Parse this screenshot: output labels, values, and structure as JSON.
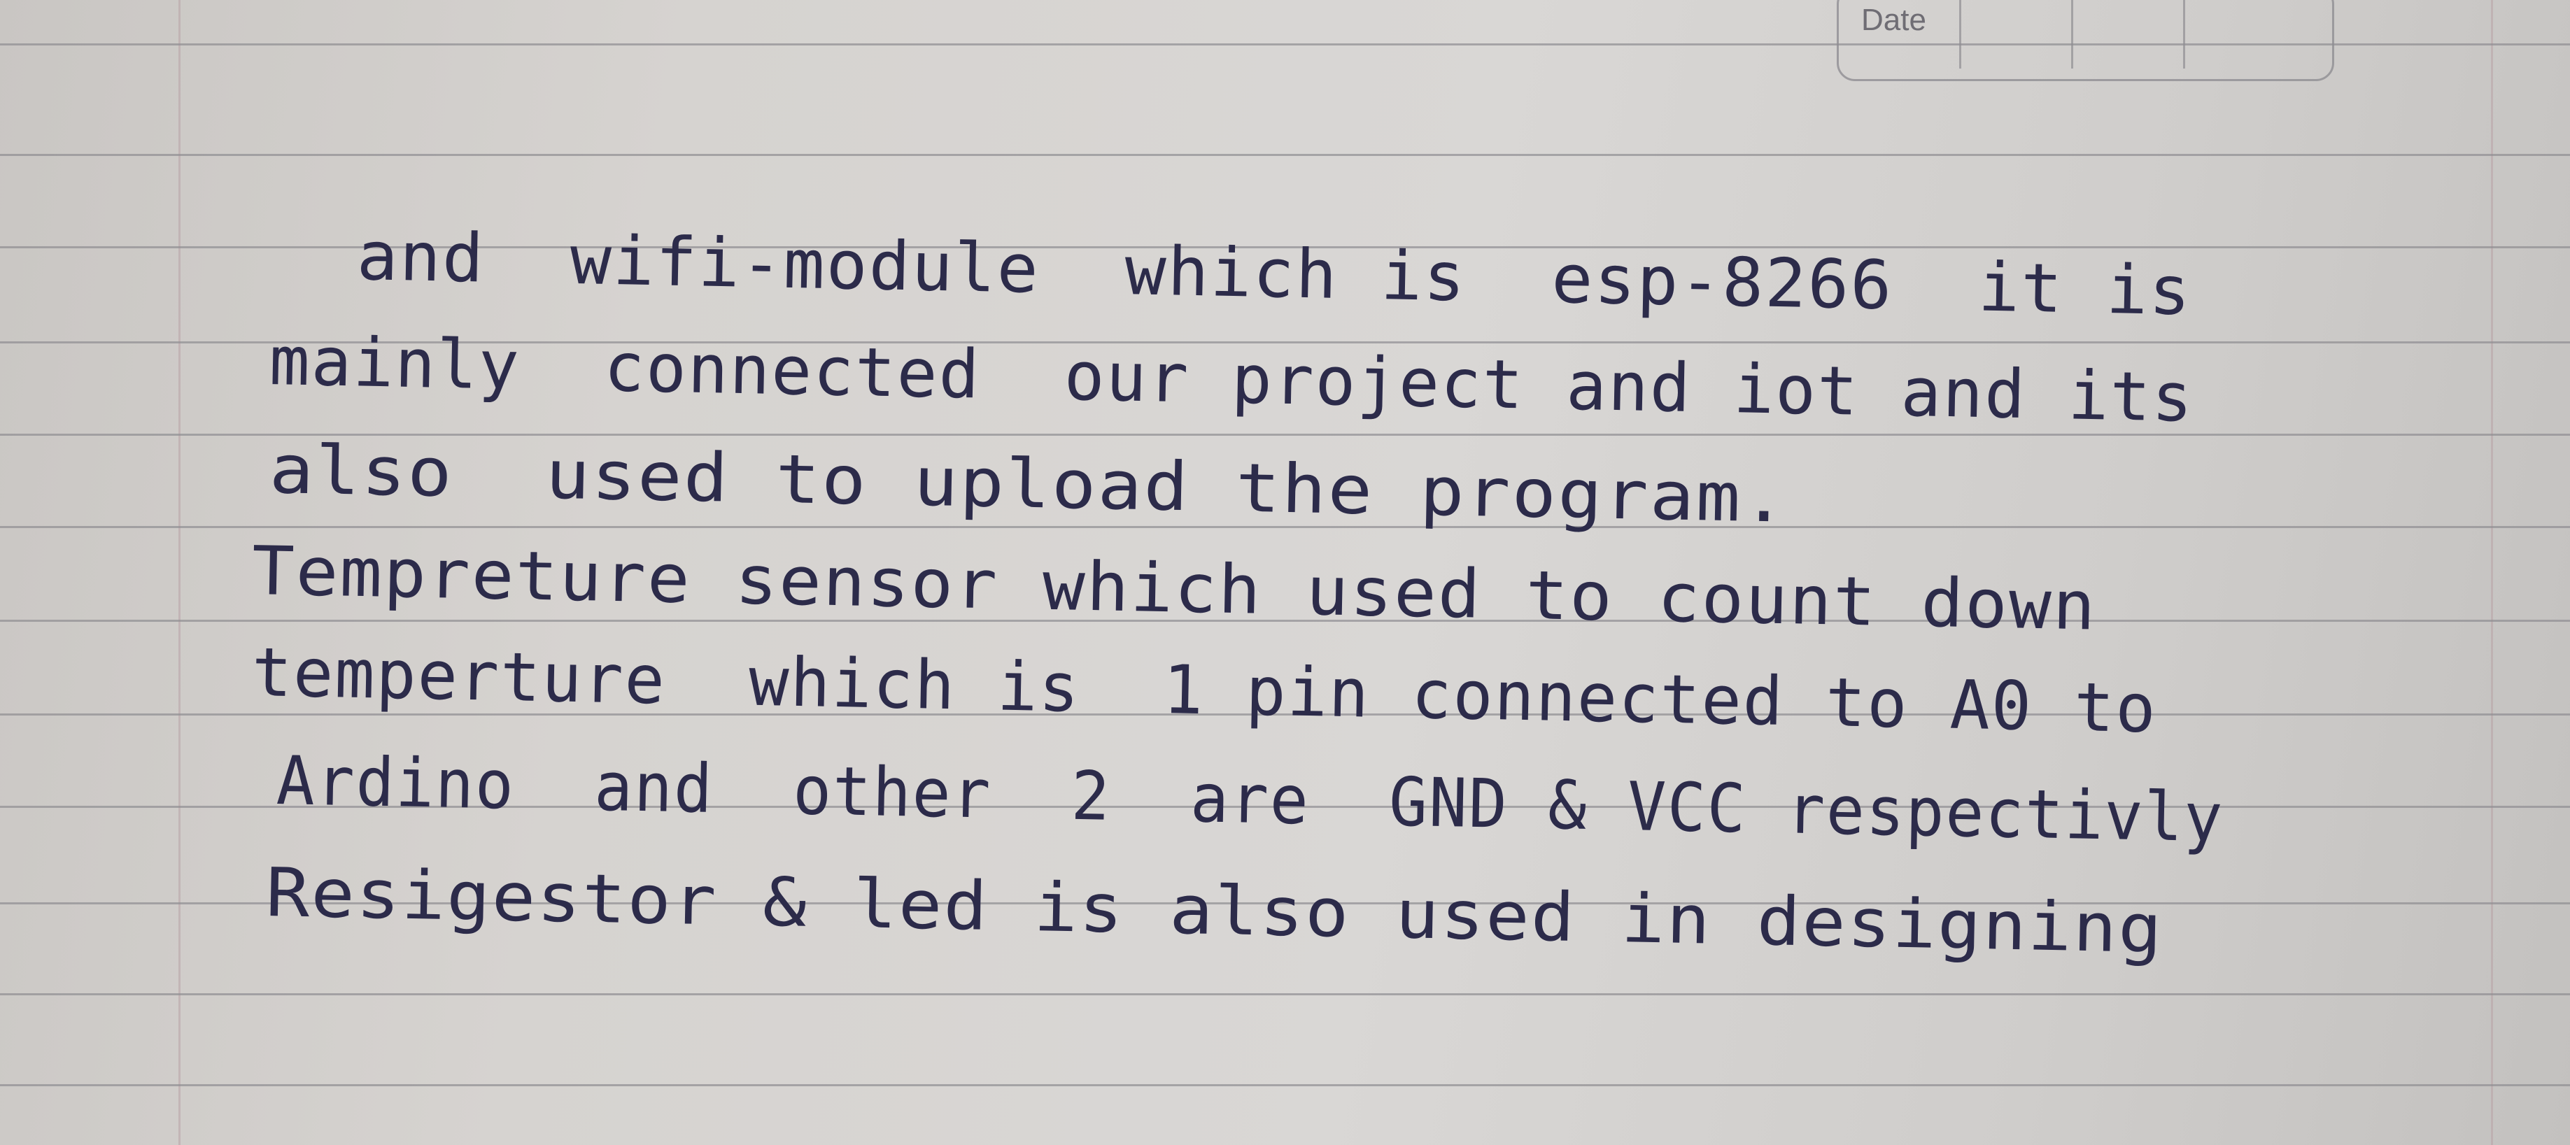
{
  "page": {
    "date_label": "Date"
  },
  "handwriting": {
    "lines": [
      "and  wifi-module  which is  esp-8266  it is",
      "mainly  connected  our project and iot and its",
      "also  used to upload the program.",
      "Tempreture sensor which used to count down",
      "temperture  which is  1 pin connected to A0 to",
      "Ardino  and  other  2  are  GND & VCC respectivly",
      "Resigestor & led is also used in designing"
    ]
  },
  "colors": {
    "ink": "#2c2b4a",
    "paper": "#d6d3d0",
    "rule": "#8f8d92",
    "margin": "#b8a3a6"
  }
}
